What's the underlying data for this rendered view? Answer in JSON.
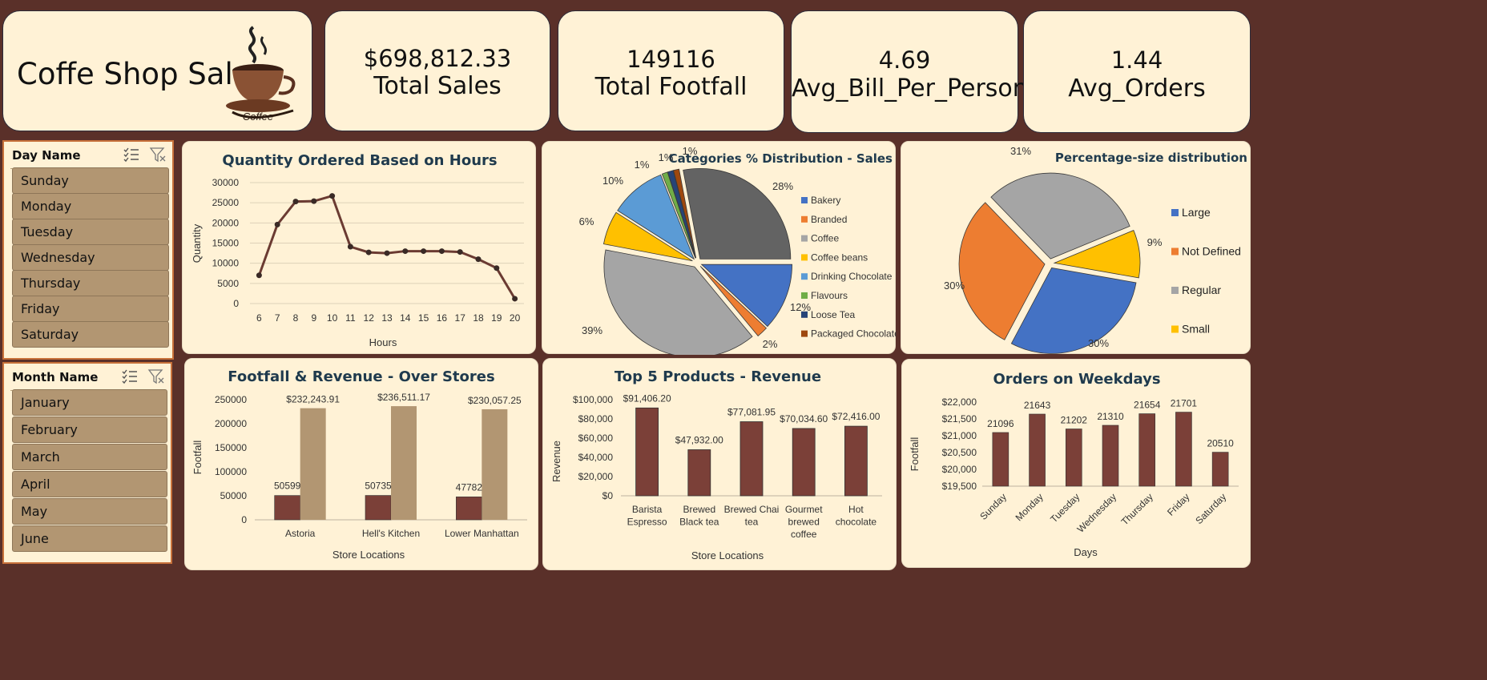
{
  "header": {
    "title": "Coffe Shop Sales",
    "logo_text": "Coffee"
  },
  "kpis": [
    {
      "value": "$698,812.33",
      "label": "Total Sales"
    },
    {
      "value": "149116",
      "label": "Total Footfall"
    },
    {
      "value": "4.69",
      "label": "Avg_Bill_Per_Person"
    },
    {
      "value": "1.44",
      "label": "Avg_Orders"
    }
  ],
  "slicers": {
    "day": {
      "title": "Day Name",
      "items": [
        "Sunday",
        "Monday",
        "Tuesday",
        "Wednesday",
        "Thursday",
        "Friday",
        "Saturday"
      ]
    },
    "month": {
      "title": "Month Name",
      "items": [
        "January",
        "February",
        "March",
        "April",
        "May",
        "June"
      ]
    }
  },
  "colors": {
    "background": "#5a3029",
    "card": "#fff2d6",
    "bar_brown": "#7b4038",
    "bar_tan": "#b29672",
    "line": "#6b3b32",
    "title": "#1f3a4d"
  },
  "chart_data": [
    {
      "id": "hours",
      "type": "line",
      "title": "Quantity Ordered Based on Hours",
      "xlabel": "Hours",
      "ylabel": "Quantity",
      "x": [
        6,
        7,
        8,
        9,
        10,
        11,
        12,
        13,
        14,
        15,
        16,
        17,
        18,
        19,
        20
      ],
      "values": [
        7000,
        19600,
        25300,
        25400,
        26700,
        14100,
        12700,
        12500,
        13000,
        13000,
        13000,
        12800,
        11000,
        8800,
        1200
      ],
      "ylim": [
        0,
        30000
      ],
      "yticks": [
        "0",
        "5000",
        "10000",
        "15000",
        "20000",
        "25000",
        "30000"
      ],
      "grid": true
    },
    {
      "id": "categories",
      "type": "pie",
      "title": "Categories % Distribution - Sales",
      "labels": [
        "Bakery",
        "Branded",
        "Coffee",
        "Coffee beans",
        "Drinking Chocolate",
        "Flavours",
        "Loose Tea",
        "Packaged Chocolate"
      ],
      "values": [
        12,
        2,
        39,
        6,
        10,
        1,
        1,
        1
      ],
      "display_labels": [
        "12%",
        "2%",
        "39%",
        "6%",
        "10%",
        "1%",
        "1%",
        "1%",
        "28%"
      ],
      "colors": [
        "#4472c4",
        "#ed7d31",
        "#a5a5a5",
        "#ffc000",
        "#5b9bd5",
        "#70ad47",
        "#264478",
        "#9e480e",
        "#636363"
      ],
      "legend": "right"
    },
    {
      "id": "sizes",
      "type": "pie",
      "title": "Percentage-size distribution",
      "labels": [
        "Large",
        "Not Defined",
        "Regular",
        "Small"
      ],
      "values": [
        30,
        30,
        31,
        9
      ],
      "display_labels": [
        "30%",
        "30%",
        "31%",
        "9%"
      ],
      "colors": [
        "#4472c4",
        "#ed7d31",
        "#a5a5a5",
        "#ffc000"
      ],
      "legend": "right"
    },
    {
      "id": "stores",
      "type": "bar",
      "title": "Footfall & Revenue - Over Stores",
      "xlabel": "Store Locations",
      "ylabel": "Footfall",
      "categories": [
        "Astoria",
        "Hell's Kitchen",
        "Lower Manhattan"
      ],
      "series": [
        {
          "values": [
            50599,
            50735,
            47782
          ],
          "labels": [
            "50599",
            "50735",
            "47782"
          ]
        },
        {
          "values": [
            232243.91,
            236511.17,
            230057.25
          ],
          "labels": [
            "$232,243.91",
            "$236,511.17",
            "$230,057.25"
          ]
        }
      ],
      "ylim": [
        0,
        250000
      ],
      "yticks": [
        "0",
        "50000",
        "100000",
        "150000",
        "200000",
        "250000"
      ]
    },
    {
      "id": "products",
      "type": "bar",
      "title": "Top 5 Products - Revenue",
      "xlabel": "Store Locations",
      "ylabel": "Revenue",
      "categories": [
        [
          "Barista",
          "Espresso"
        ],
        [
          "Brewed",
          "Black tea"
        ],
        [
          "Brewed Chai",
          "tea"
        ],
        [
          "Gourmet",
          "brewed",
          "coffee"
        ],
        [
          "Hot",
          "chocolate"
        ]
      ],
      "values": [
        91406.2,
        47932.0,
        77081.95,
        70034.6,
        72416.0
      ],
      "labels": [
        "$91,406.20",
        "$47,932.00",
        "$77,081.95",
        "$70,034.60",
        "$72,416.00"
      ],
      "ylim": [
        0,
        100000
      ],
      "yticks": [
        "$0",
        "$20,000",
        "$40,000",
        "$60,000",
        "$80,000",
        "$100,000"
      ]
    },
    {
      "id": "weekdays",
      "type": "bar",
      "title": "Orders on Weekdays",
      "xlabel": "Days",
      "ylabel": "Footfall",
      "categories": [
        "Sunday",
        "Monday",
        "Tuesday",
        "Wednesday",
        "Thursday",
        "Friday",
        "Saturday"
      ],
      "values": [
        21096,
        21643,
        21202,
        21310,
        21654,
        21701,
        20510
      ],
      "labels": [
        "21096",
        "21643",
        "21202",
        "21310",
        "21654",
        "21701",
        "20510"
      ],
      "ylim": [
        19500,
        22000
      ],
      "yticks": [
        "$19,500",
        "$20,000",
        "$20,500",
        "$21,000",
        "$21,500",
        "$22,000"
      ]
    }
  ]
}
